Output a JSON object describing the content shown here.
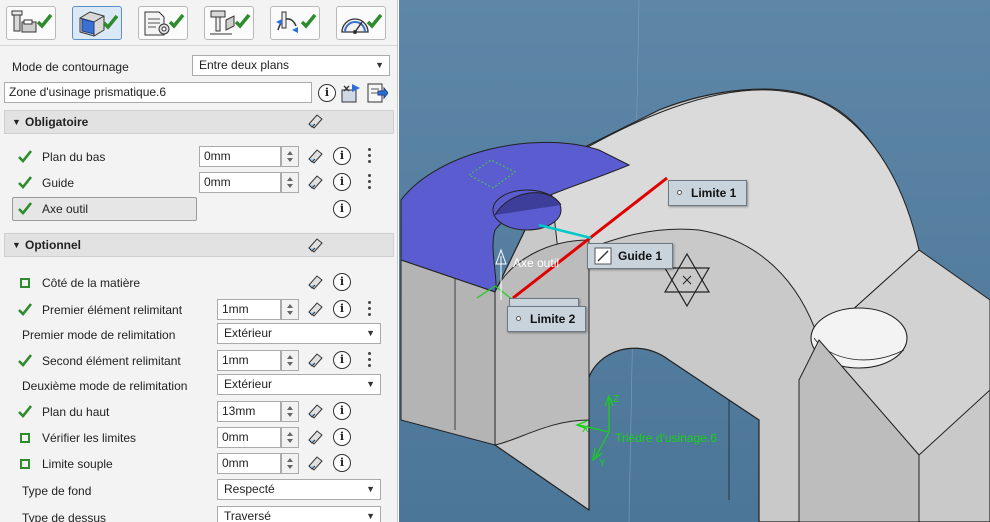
{
  "toolbar": {
    "tabs": [
      {
        "name": "machine-tab",
        "icon": "machine-icon",
        "active": false
      },
      {
        "name": "geometry-tab",
        "icon": "geometry-icon",
        "active": true
      },
      {
        "name": "strategy-tab",
        "icon": "strategy-icon",
        "active": false
      },
      {
        "name": "tool-tab",
        "icon": "tool-icon",
        "active": false
      },
      {
        "name": "macro-tab",
        "icon": "macro-icon",
        "active": false
      },
      {
        "name": "feeds-tab",
        "icon": "feeds-icon",
        "active": false
      }
    ],
    "check_color": "#2e8b2e"
  },
  "contour_mode": {
    "label": "Mode de contournage",
    "value": "Entre deux plans"
  },
  "zone": {
    "value": "Zone d'usinage prismatique.6"
  },
  "obligatoire": {
    "title": "Obligatoire",
    "rows": [
      {
        "label": "Plan du bas",
        "value": "0mm",
        "status": "checked"
      },
      {
        "label": "Guide",
        "value": "0mm",
        "status": "checked"
      },
      {
        "label": "Axe outil",
        "status": "checked"
      }
    ]
  },
  "optionnel": {
    "title": "Optionnel",
    "cote_matiere": {
      "label": "Côté de la matière",
      "status": "unchecked"
    },
    "premier_element": {
      "label": "Premier élément relimitant",
      "value": "1mm",
      "status": "checked"
    },
    "premier_mode": {
      "label": "Premier mode de relimitation",
      "value": "Extérieur"
    },
    "second_element": {
      "label": "Second élément relimitant",
      "value": "1mm",
      "status": "checked"
    },
    "deuxieme_mode": {
      "label": "Deuxième mode de relimitation",
      "value": "Extérieur"
    },
    "plan_haut": {
      "label": "Plan du haut",
      "value": "13mm",
      "status": "checked"
    },
    "verifier_limites": {
      "label": "Vérifier les limites",
      "value": "0mm",
      "status": "unchecked"
    },
    "limite_souple": {
      "label": "Limite souple",
      "value": "0mm",
      "status": "unchecked"
    },
    "type_fond": {
      "label": "Type de fond",
      "value": "Respecté"
    },
    "type_dessus": {
      "label": "Type de dessus",
      "value": "Traversé"
    }
  },
  "viewport": {
    "background": "#5a83a4",
    "labels": {
      "limite1": "Limite 1",
      "guide1": "Guide 1",
      "limite2": "Limite 2",
      "axe_outil": "Axe outil",
      "triedre": "Trièdre d'usinage.6"
    },
    "axes": {
      "x": "X",
      "y": "Y",
      "z": "Z"
    },
    "colors": {
      "face_selected": "#5a5ccf",
      "limit_line": "#e00000",
      "guide_line": "#00c8c8",
      "axis_green": "#17d217"
    }
  }
}
